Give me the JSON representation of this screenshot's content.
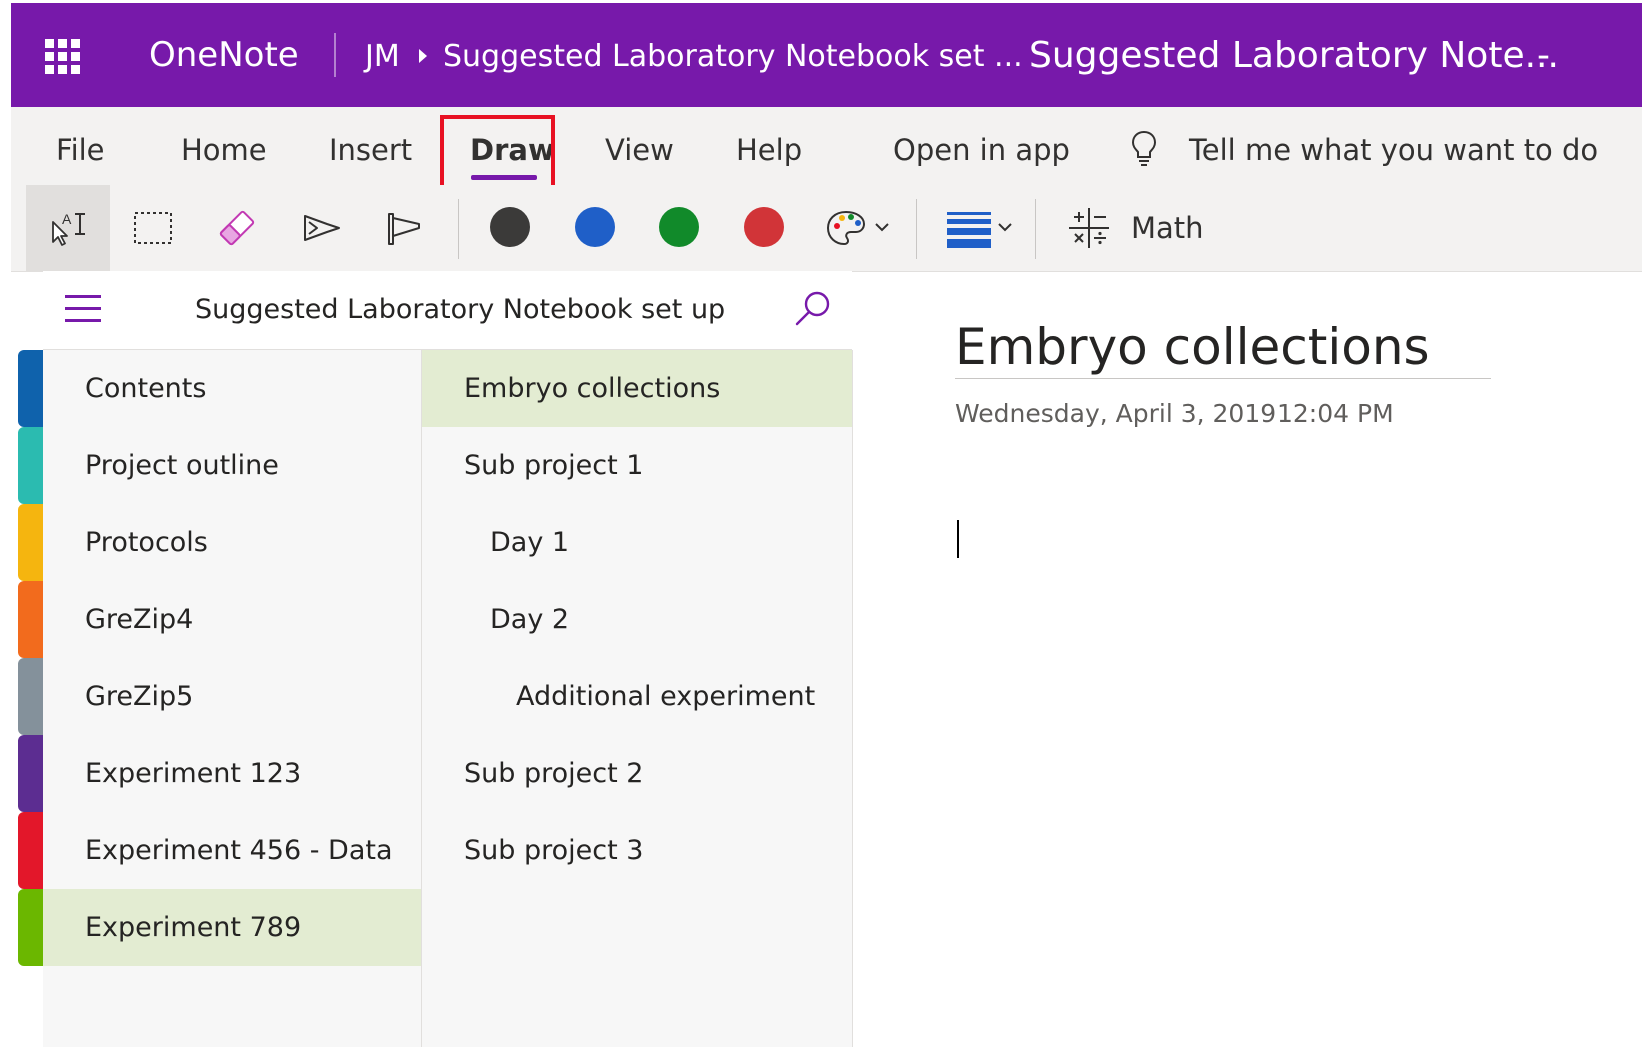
{
  "titlebar": {
    "app_name": "OneNote",
    "breadcrumb_user": "JM",
    "breadcrumb_notebook": "Suggested Laboratory Notebook set ...",
    "document_title": "Suggested Laboratory Note...",
    "title_suffix": "-"
  },
  "menu": {
    "file": "File",
    "home": "Home",
    "insert": "Insert",
    "draw": "Draw",
    "view": "View",
    "help": "Help",
    "open_in_app": "Open in app",
    "tell_me": "Tell me what you want to do",
    "active_tab": "Draw"
  },
  "ribbon": {
    "tools": [
      "type-select-icon",
      "lasso-select-icon",
      "eraser-icon",
      "pen-icon",
      "highlighter-icon"
    ],
    "pen_colors": [
      "#3b3a39",
      "#1f5fc8",
      "#118a2a",
      "#d13438"
    ],
    "color_picker_icon": "palette-icon",
    "thickness_icon": "thickness-icon",
    "math_icon": "math-icon",
    "math_label": "Math"
  },
  "nav": {
    "notebook_title": "Suggested Laboratory Notebook set up",
    "sections": [
      {
        "label": "Contents",
        "color": "#0f62ac"
      },
      {
        "label": "Project outline",
        "color": "#2bbbb0"
      },
      {
        "label": "Protocols",
        "color": "#f5b50f"
      },
      {
        "label": "GreZip4",
        "color": "#f26b1d"
      },
      {
        "label": "GreZip5",
        "color": "#84919b"
      },
      {
        "label": "Experiment 123",
        "color": "#5c2d91"
      },
      {
        "label": "Experiment 456 - Data",
        "color": "#e3172a"
      },
      {
        "label": "Experiment 789",
        "color": "#6bb700"
      }
    ],
    "selected_section": "Experiment 789",
    "pages": [
      {
        "label": "Embryo collections",
        "level": 0
      },
      {
        "label": "Sub project 1",
        "level": 0
      },
      {
        "label": "Day 1",
        "level": 1
      },
      {
        "label": "Day 2",
        "level": 1
      },
      {
        "label": "Additional experiment",
        "level": 2
      },
      {
        "label": "Sub project 2",
        "level": 0
      },
      {
        "label": "Sub project 3",
        "level": 0
      }
    ],
    "selected_page": "Embryo collections"
  },
  "page": {
    "title": "Embryo collections",
    "date": "Wednesday, April 3, 2019",
    "time": "12:04 PM"
  },
  "colors": {
    "brand": "#7719aa",
    "selected_row": "#e3ecd2",
    "highlight_box": "#e81123"
  }
}
